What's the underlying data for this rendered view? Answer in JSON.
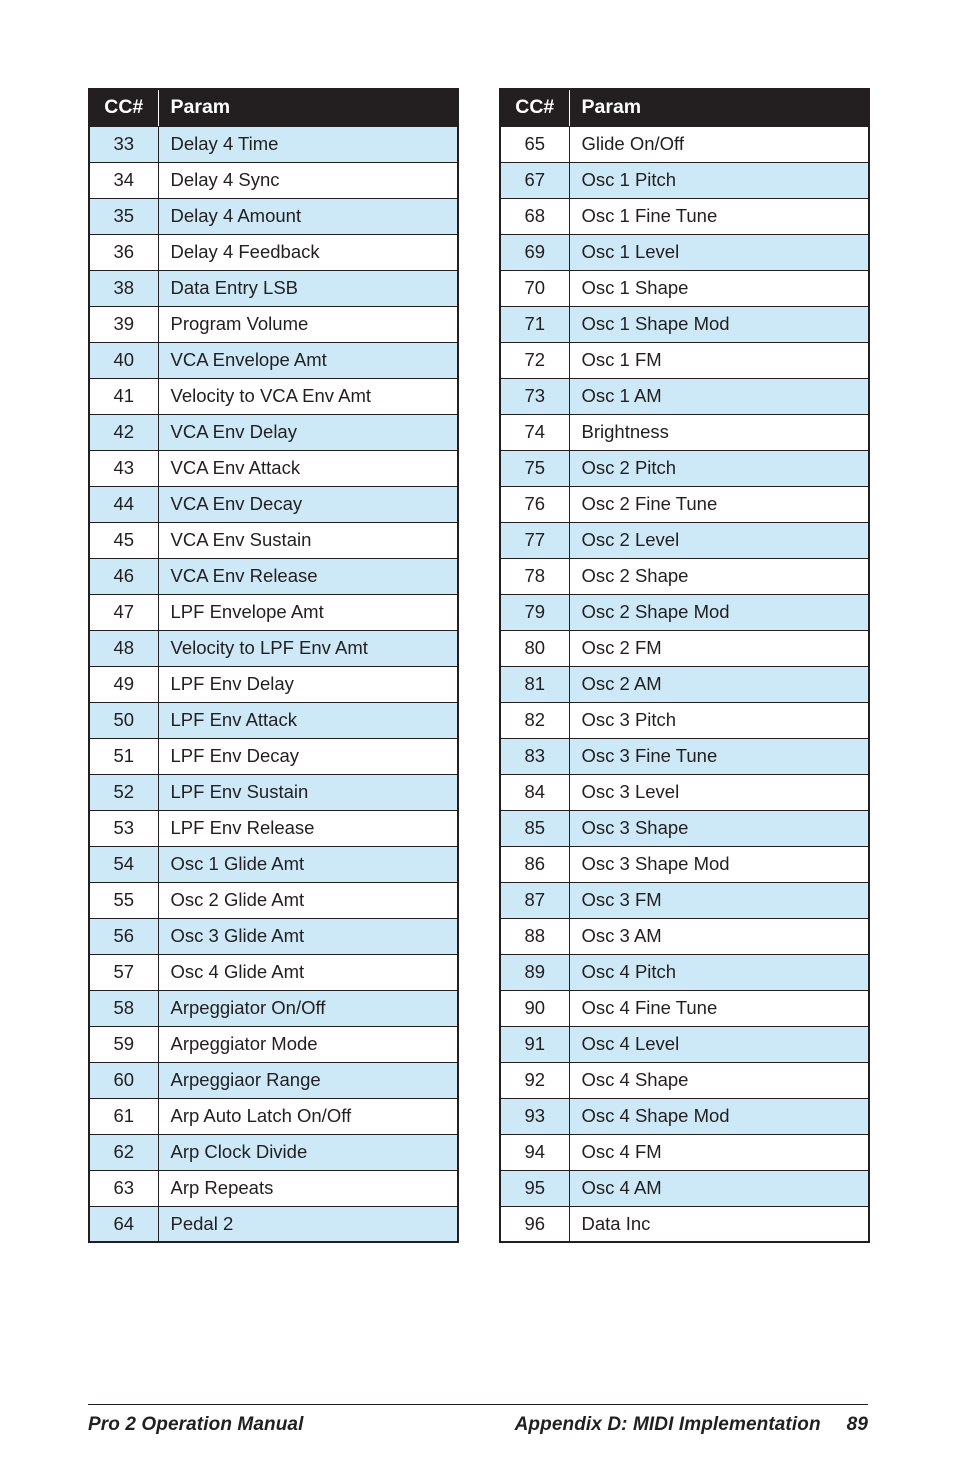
{
  "document": {
    "title": "Pro 2 Operation Manual",
    "section": "Appendix D: MIDI Implementation",
    "page_number": "89"
  },
  "tables": {
    "columns": {
      "cc": "CC#",
      "param": "Param"
    },
    "left": {
      "header": {
        "cc": "CC#",
        "param": "Param"
      },
      "rows": [
        {
          "cc": "33",
          "param": "Delay 4 Time",
          "shaded": true
        },
        {
          "cc": "34",
          "param": "Delay 4 Sync",
          "shaded": false
        },
        {
          "cc": "35",
          "param": "Delay 4 Amount",
          "shaded": true
        },
        {
          "cc": "36",
          "param": "Delay 4 Feedback",
          "shaded": false
        },
        {
          "cc": "38",
          "param": "Data Entry LSB",
          "shaded": true
        },
        {
          "cc": "39",
          "param": "Program Volume",
          "shaded": false
        },
        {
          "cc": "40",
          "param": "VCA Envelope Amt",
          "shaded": true
        },
        {
          "cc": "41",
          "param": "Velocity to VCA Env Amt",
          "shaded": false
        },
        {
          "cc": "42",
          "param": "VCA Env Delay",
          "shaded": true
        },
        {
          "cc": "43",
          "param": "VCA Env Attack",
          "shaded": false
        },
        {
          "cc": "44",
          "param": "VCA Env Decay",
          "shaded": true
        },
        {
          "cc": "45",
          "param": "VCA Env Sustain",
          "shaded": false
        },
        {
          "cc": "46",
          "param": "VCA Env Release",
          "shaded": true
        },
        {
          "cc": "47",
          "param": "LPF Envelope Amt",
          "shaded": false
        },
        {
          "cc": "48",
          "param": "Velocity to LPF Env Amt",
          "shaded": true
        },
        {
          "cc": "49",
          "param": "LPF Env Delay",
          "shaded": false
        },
        {
          "cc": "50",
          "param": "LPF Env Attack",
          "shaded": true
        },
        {
          "cc": "51",
          "param": "LPF Env Decay",
          "shaded": false
        },
        {
          "cc": "52",
          "param": "LPF Env Sustain",
          "shaded": true
        },
        {
          "cc": "53",
          "param": "LPF Env Release",
          "shaded": false
        },
        {
          "cc": "54",
          "param": "Osc 1 Glide Amt",
          "shaded": true
        },
        {
          "cc": "55",
          "param": "Osc 2 Glide Amt",
          "shaded": false
        },
        {
          "cc": "56",
          "param": "Osc 3 Glide Amt",
          "shaded": true
        },
        {
          "cc": "57",
          "param": "Osc 4 Glide Amt",
          "shaded": false
        },
        {
          "cc": "58",
          "param": "Arpeggiator On/Off",
          "shaded": true
        },
        {
          "cc": "59",
          "param": "Arpeggiator Mode",
          "shaded": false
        },
        {
          "cc": "60",
          "param": "Arpeggiaor Range",
          "shaded": true
        },
        {
          "cc": "61",
          "param": "Arp Auto Latch On/Off",
          "shaded": false
        },
        {
          "cc": "62",
          "param": "Arp Clock Divide",
          "shaded": true
        },
        {
          "cc": "63",
          "param": "Arp Repeats",
          "shaded": false
        },
        {
          "cc": "64",
          "param": "Pedal 2",
          "shaded": true
        }
      ]
    },
    "right": {
      "header": {
        "cc": "CC#",
        "param": "Param"
      },
      "rows": [
        {
          "cc": "65",
          "param": "Glide On/Off",
          "shaded": false
        },
        {
          "cc": "67",
          "param": "Osc 1 Pitch",
          "shaded": true
        },
        {
          "cc": "68",
          "param": "Osc 1 Fine Tune",
          "shaded": false
        },
        {
          "cc": "69",
          "param": "Osc 1 Level",
          "shaded": true
        },
        {
          "cc": "70",
          "param": "Osc 1 Shape",
          "shaded": false
        },
        {
          "cc": "71",
          "param": "Osc 1 Shape Mod",
          "shaded": true
        },
        {
          "cc": "72",
          "param": "Osc 1 FM",
          "shaded": false
        },
        {
          "cc": "73",
          "param": "Osc 1 AM",
          "shaded": true
        },
        {
          "cc": "74",
          "param": "Brightness",
          "shaded": false
        },
        {
          "cc": "75",
          "param": "Osc 2 Pitch",
          "shaded": true
        },
        {
          "cc": "76",
          "param": "Osc 2 Fine Tune",
          "shaded": false
        },
        {
          "cc": "77",
          "param": "Osc 2 Level",
          "shaded": true
        },
        {
          "cc": "78",
          "param": "Osc 2 Shape",
          "shaded": false
        },
        {
          "cc": "79",
          "param": "Osc 2 Shape Mod",
          "shaded": true
        },
        {
          "cc": "80",
          "param": "Osc 2 FM",
          "shaded": false
        },
        {
          "cc": "81",
          "param": "Osc 2 AM",
          "shaded": true
        },
        {
          "cc": "82",
          "param": "Osc 3 Pitch",
          "shaded": false
        },
        {
          "cc": "83",
          "param": "Osc 3 Fine Tune",
          "shaded": true
        },
        {
          "cc": "84",
          "param": "Osc 3 Level",
          "shaded": false
        },
        {
          "cc": "85",
          "param": "Osc 3 Shape",
          "shaded": true
        },
        {
          "cc": "86",
          "param": "Osc 3 Shape Mod",
          "shaded": false
        },
        {
          "cc": "87",
          "param": "Osc 3 FM",
          "shaded": true
        },
        {
          "cc": "88",
          "param": "Osc 3 AM",
          "shaded": false
        },
        {
          "cc": "89",
          "param": "Osc 4 Pitch",
          "shaded": true
        },
        {
          "cc": "90",
          "param": "Osc 4 Fine Tune",
          "shaded": false
        },
        {
          "cc": "91",
          "param": "Osc 4 Level",
          "shaded": true
        },
        {
          "cc": "92",
          "param": "Osc 4 Shape",
          "shaded": false
        },
        {
          "cc": "93",
          "param": "Osc 4 Shape Mod",
          "shaded": true
        },
        {
          "cc": "94",
          "param": "Osc 4 FM",
          "shaded": false
        },
        {
          "cc": "95",
          "param": "Osc 4 AM",
          "shaded": true
        },
        {
          "cc": "96",
          "param": "Data Inc",
          "shaded": false
        }
      ]
    }
  },
  "colors": {
    "header_background": "#231f20",
    "header_text": "#ffffff",
    "row_shaded": "#cde9f7",
    "row_plain": "#ffffff",
    "border": "#231f20",
    "text": "#231f20"
  }
}
